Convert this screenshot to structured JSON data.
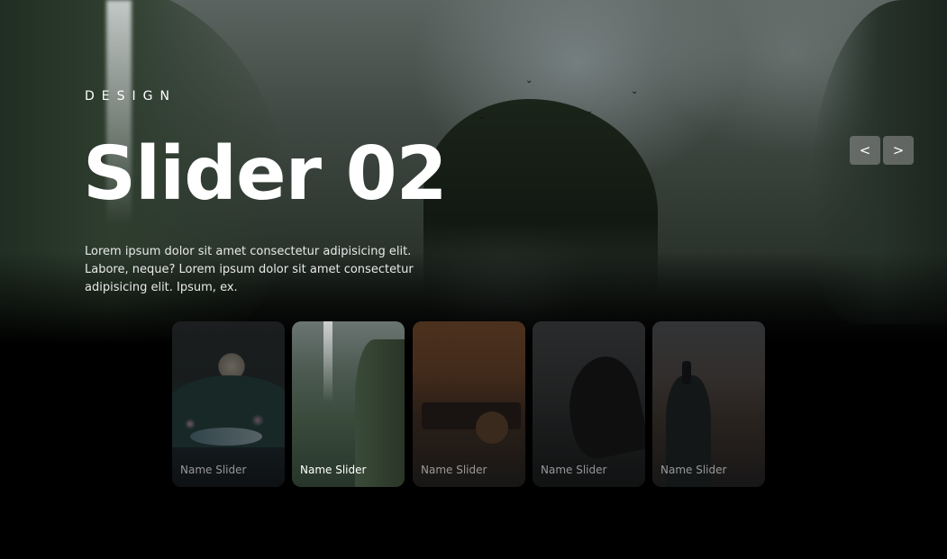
{
  "hero": {
    "eyebrow": "DESIGN",
    "title": "Slider 02",
    "description": "Lorem ipsum dolor sit amet consectetur adipisicing elit. Labore, neque? Lorem ipsum dolor sit amet consectetur adipisicing elit. Ipsum, ex."
  },
  "navigation": {
    "prev_label": "<",
    "next_label": ">"
  },
  "thumbnails": [
    {
      "label": "Name Slider",
      "active": false
    },
    {
      "label": "Name Slider",
      "active": true
    },
    {
      "label": "Name Slider",
      "active": false
    },
    {
      "label": "Name Slider",
      "active": false
    },
    {
      "label": "Name Slider",
      "active": false
    }
  ]
}
